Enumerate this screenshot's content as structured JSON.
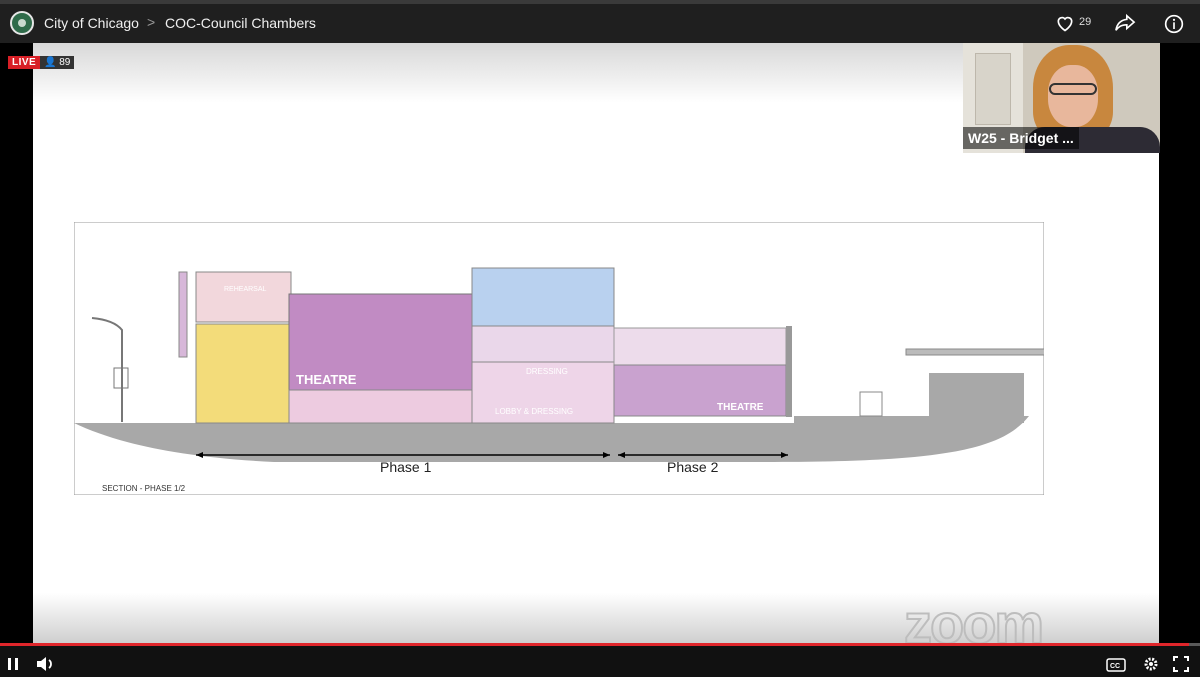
{
  "header": {
    "org": "City of Chicago",
    "separator": ">",
    "channel": "COC-Council Chambers",
    "likes": "29"
  },
  "stream": {
    "live_label": "LIVE",
    "viewers": "89",
    "speaker_name": "W25 - Bridget ...",
    "watermark": "zoom"
  },
  "drawing": {
    "phase1": "Phase 1",
    "phase2": "Phase 2",
    "section_label": "SECTION - PHASE 1/2",
    "theatre_main": "THEATRE",
    "theatre_small": "THEATRE",
    "dressing": "DRESSING",
    "lobby_dressing": "LOBBY & DRESSING",
    "rehearsal": "REHEARSAL"
  },
  "player": {
    "progress": 0.991,
    "accent_color": "#e0262b"
  },
  "icons": [
    "logo-icon",
    "heart-icon",
    "share-icon",
    "info-icon",
    "viewer-icon",
    "pause-icon",
    "volume-icon",
    "cc-icon",
    "gear-icon",
    "fullscreen-icon"
  ]
}
